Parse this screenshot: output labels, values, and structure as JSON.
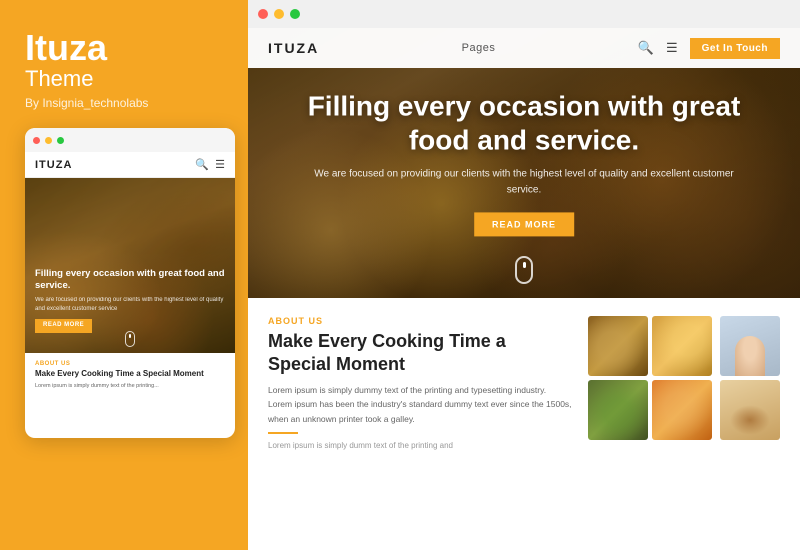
{
  "leftPanel": {
    "brandTitle": "Ituza",
    "brandSubtitle": "Theme",
    "brandBy": "By Insignia_technolabs"
  },
  "miniBrowser": {
    "dots": [
      "red",
      "yellow",
      "green"
    ],
    "nav": {
      "logo": "ITUZA",
      "icons": [
        "search",
        "menu"
      ]
    },
    "hero": {
      "title": "Filling every occasion with great food and service.",
      "subtitle": "We are focused on providing our clients with the highest level of quality and excellent customer service",
      "ctaLabel": "READ MORE"
    },
    "about": {
      "label": "ABOUT US",
      "title": "Make Every Cooking Time a Special Moment",
      "body": "Lorem ipsum is simply dummy text of the printing..."
    }
  },
  "mainBrowser": {
    "dots": [
      "red",
      "yellow",
      "green"
    ],
    "nav": {
      "logo": "ITUZA",
      "pagesLabel": "Pages",
      "icons": [
        "search",
        "menu"
      ],
      "ctaLabel": "Get In Touch"
    },
    "hero": {
      "title": "Filling every occasion with great food and service.",
      "subtitle": "We are focused on providing our clients with the highest level of quality and excellent customer service.",
      "ctaLabel": "READ MORE"
    },
    "about": {
      "label": "ABOUT US",
      "title": "Make Every Cooking Time a Special Moment",
      "body": "Lorem ipsum is simply dummy text of the printing and typesetting industry. Lorem ipsum has been the industry's standard dummy text ever since the 1500s, when an unknown printer took a galley.",
      "body2": "Lorem ipsum is simply dumm text of the printing and"
    }
  }
}
